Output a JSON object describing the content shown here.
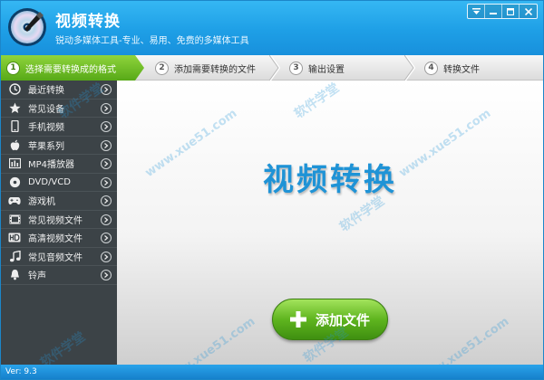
{
  "titlebar": {
    "title": "视频转换",
    "subtitle": "锐动多媒体工具-专业、易用、免费的多媒体工具",
    "buttons": [
      "menu",
      "minimize",
      "maximize",
      "close"
    ]
  },
  "steps": [
    {
      "num": "1",
      "label": "选择需要转换成的格式",
      "active": true
    },
    {
      "num": "2",
      "label": "添加需要转换的文件",
      "active": false
    },
    {
      "num": "3",
      "label": "输出设置",
      "active": false
    },
    {
      "num": "4",
      "label": "转换文件",
      "active": false
    }
  ],
  "sidebar": {
    "items": [
      {
        "label": "最近转换",
        "icon": "clock-icon"
      },
      {
        "label": "常见设备",
        "icon": "star-icon"
      },
      {
        "label": "手机视频",
        "icon": "phone-icon"
      },
      {
        "label": "苹果系列",
        "icon": "apple-icon"
      },
      {
        "label": "MP4播放器",
        "icon": "mp4-player-icon"
      },
      {
        "label": "DVD/VCD",
        "icon": "disc-icon"
      },
      {
        "label": "游戏机",
        "icon": "gamepad-icon"
      },
      {
        "label": "常见视频文件",
        "icon": "film-icon"
      },
      {
        "label": "高清视频文件",
        "icon": "hd-icon"
      },
      {
        "label": "常见音频文件",
        "icon": "music-icon"
      },
      {
        "label": "铃声",
        "icon": "bell-icon"
      }
    ]
  },
  "main": {
    "title": "视频转换",
    "add_button_label": "添加文件"
  },
  "watermark": {
    "text_a": "软件学堂",
    "text_b": "www.xue51.com"
  },
  "status": {
    "version": "Ver: 9.3"
  },
  "colors": {
    "accent_blue": "#1e9fe6",
    "active_green": "#57a917",
    "sidebar_bg": "#3c4347"
  }
}
